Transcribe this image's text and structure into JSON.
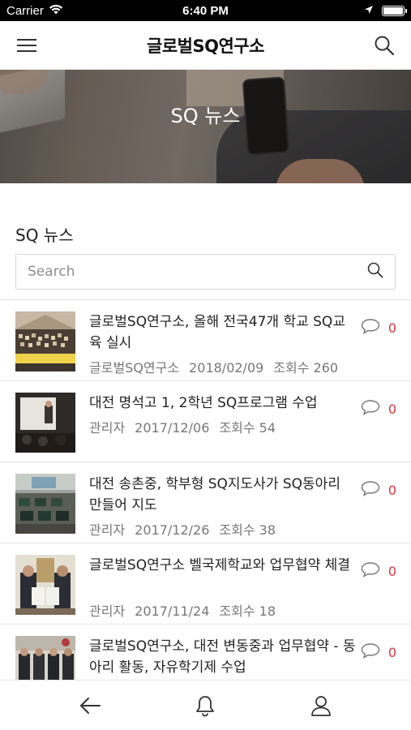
{
  "status_bar": {
    "carrier": "Carrier",
    "time": "6:40 PM"
  },
  "header": {
    "title": "글로벌SQ연구소",
    "menu_icon": "hamburger-icon",
    "search_icon": "search-icon"
  },
  "hero": {
    "title": "SQ 뉴스"
  },
  "section": {
    "title": "SQ 뉴스"
  },
  "search": {
    "placeholder": "Search",
    "value": ""
  },
  "news": [
    {
      "title": "글로벌SQ연구소, 올해 전국47개 학교 SQ교육 실시",
      "author": "글로벌SQ연구소",
      "date": "2018/02/09",
      "views": "조회수 260",
      "comments": "0"
    },
    {
      "title": "대전 명석고 1, 2학년 SQ프로그램 수업",
      "author": "관리자",
      "date": "2017/12/06",
      "views": "조회수 54",
      "comments": "0"
    },
    {
      "title": "대전 송촌중, 학부형 SQ지도사가 SQ동아리 만들어 지도",
      "author": "관리자",
      "date": "2017/12/26",
      "views": "조회수 38",
      "comments": "0"
    },
    {
      "title": "글로벌SQ연구소 벨국제학교와 업무협약 체결",
      "author": "관리자",
      "date": "2017/11/24",
      "views": "조회수 18",
      "comments": "0"
    },
    {
      "title": "글로벌SQ연구소, 대전 변동중과 업무협약 - 동아리 활동, 자유학기제 수업",
      "author": "",
      "date": "",
      "views": "",
      "comments": "0"
    }
  ],
  "tabbar": {
    "back_icon": "back-arrow-icon",
    "notification_icon": "bell-icon",
    "profile_icon": "user-icon"
  },
  "colors": {
    "comment_count": "#e0353f",
    "divider": "#e4e4e4"
  }
}
